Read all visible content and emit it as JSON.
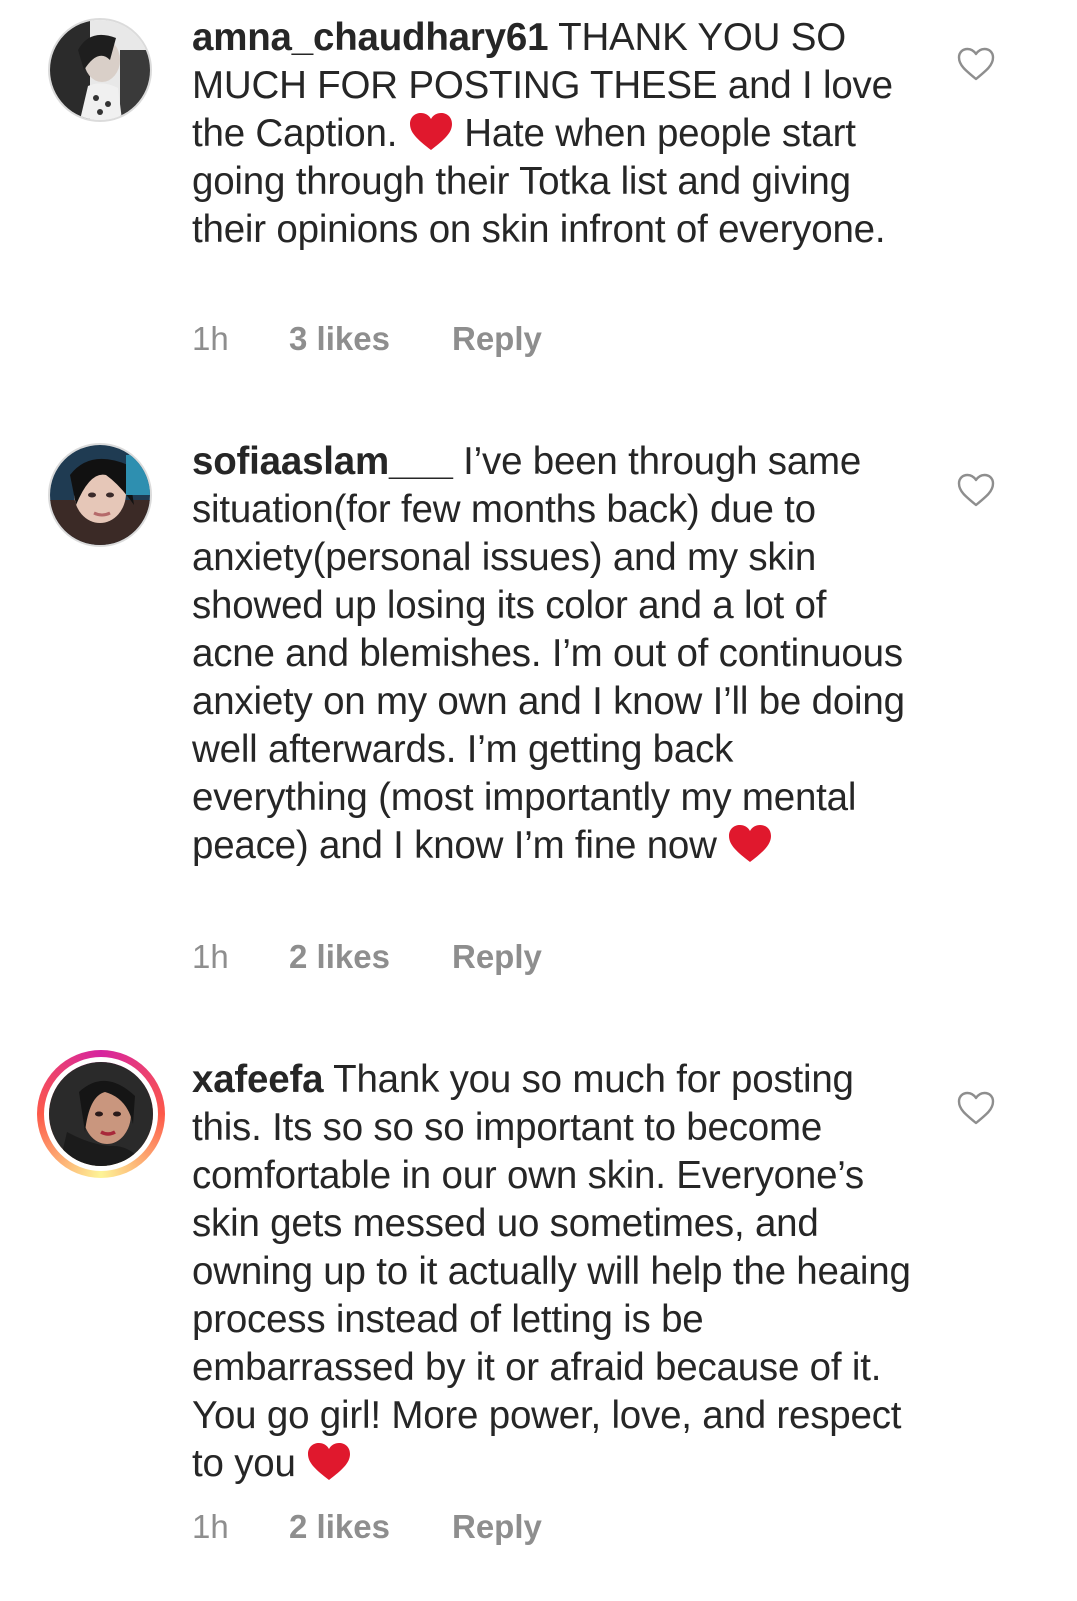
{
  "comments": [
    {
      "username": "amna_chaudhary61",
      "text_before": "THANK YOU SO MUCH FOR POSTING THESE and I love the Caption.",
      "text_after": "Hate when people start going through their Totka list and giving their opinions on skin infront of everyone.",
      "time": "1h",
      "likes": "3 likes",
      "reply": "Reply"
    },
    {
      "username": "sofiaaslam___",
      "text_before": "I’ve been through same situation(for few months back) due to anxiety(personal issues) and my skin showed up losing its color and a lot of acne and blemishes. I’m out of continuous anxiety on my own and I know I’ll be doing well afterwards. I’m getting back everything (most importantly my mental peace) and I know I’m fine now",
      "time": "1h",
      "likes": "2 likes",
      "reply": "Reply"
    },
    {
      "username": "xafeefa",
      "text_before": "Thank you so much for posting this. Its so so so important to become comfortable in our own skin. Everyone’s skin gets messed uo sometimes, and owning up to it actually will help the heaing process instead of letting is be embarrassed by it or afraid because of it. You go girl! More power, love, and respect to you",
      "time": "1h",
      "likes": "2 likes",
      "reply": "Reply"
    }
  ],
  "icons": {
    "like": "heart-outline-icon",
    "emoji": "red-heart-emoji"
  },
  "colors": {
    "text": "#262626",
    "meta": "#8e8e8e",
    "heart_emoji": "#e0182d"
  }
}
